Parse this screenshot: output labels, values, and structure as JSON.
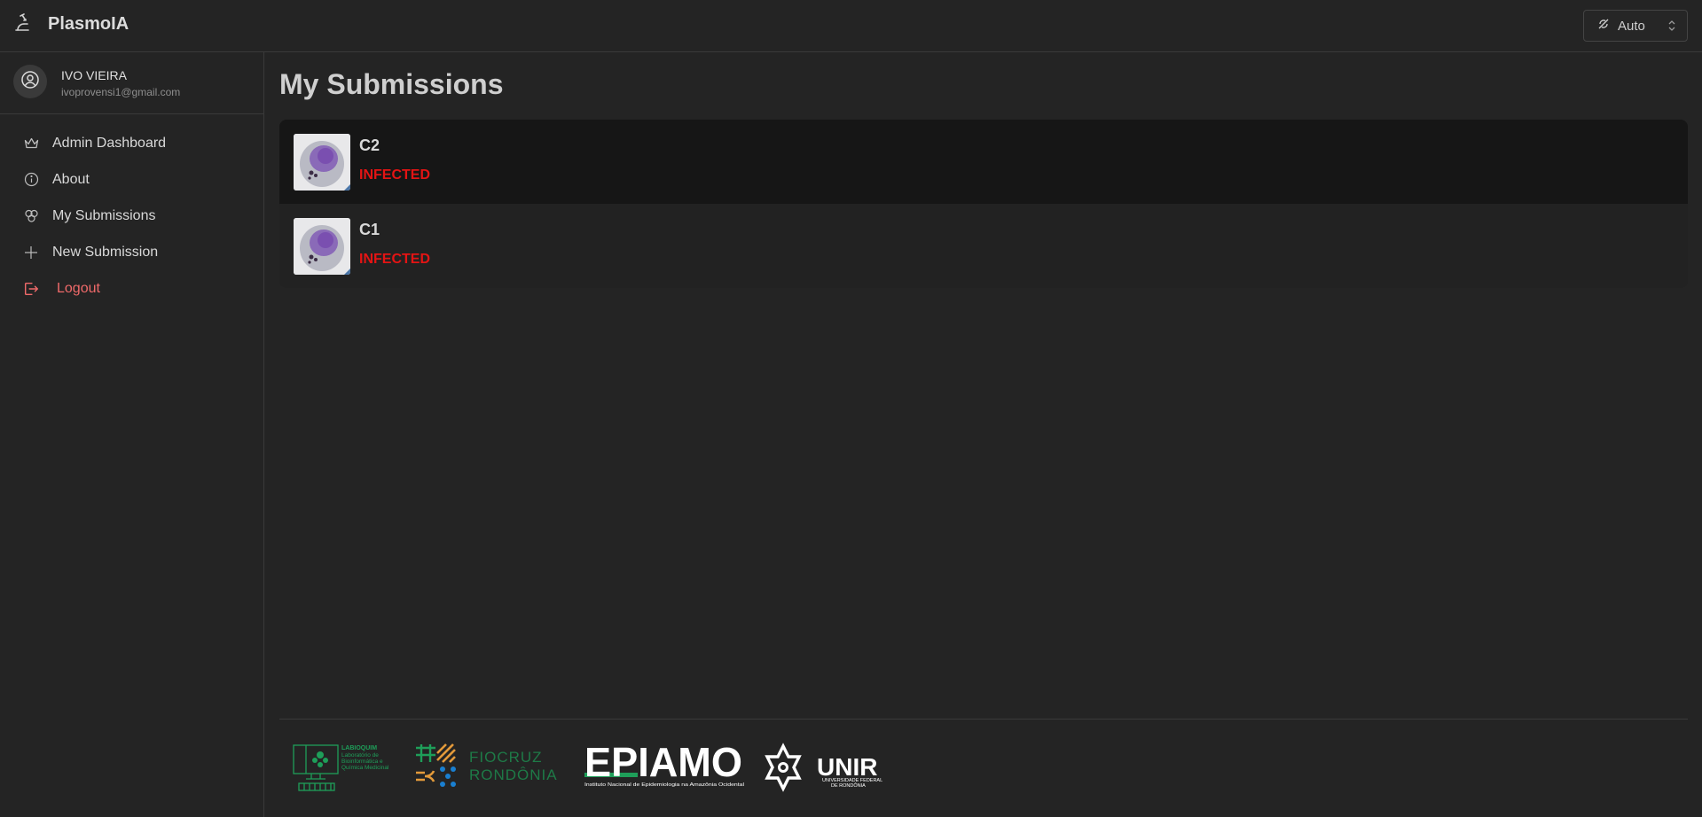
{
  "app": {
    "title": "PlasmoIA"
  },
  "theme": {
    "label": "Auto"
  },
  "user": {
    "name": "IVO VIEIRA",
    "email": "ivoprovensi1@gmail.com"
  },
  "nav": {
    "items": [
      {
        "label": "Admin Dashboard",
        "icon": "crown-icon"
      },
      {
        "label": "About",
        "icon": "info-icon"
      },
      {
        "label": "My Submissions",
        "icon": "circles-icon"
      },
      {
        "label": "New Submission",
        "icon": "plus-icon"
      },
      {
        "label": "Logout",
        "icon": "logout-icon"
      }
    ]
  },
  "main": {
    "title": "My Submissions",
    "submissions": [
      {
        "name": "C2",
        "status": "INFECTED"
      },
      {
        "name": "C1",
        "status": "INFECTED"
      }
    ]
  },
  "footer": {
    "logos": [
      {
        "name": "LABIOQUIM",
        "lines": [
          "LABIOQUIM",
          "Laboratório de",
          "Bioinformática e",
          "Química Medicinal"
        ]
      },
      {
        "name": "FIOCRUZ RONDÔNIA",
        "lines": [
          "FIOCRUZ",
          "RONDÔNIA"
        ]
      },
      {
        "name": "EPIAMO",
        "lines": [
          "EPIAMO",
          "Instituto Nacional de Epidemiologia na Amazônia Ocidental"
        ]
      },
      {
        "name": "UNIR",
        "lines": [
          "UNIR",
          "UNIVERSIDADE FEDERAL",
          "DE RONDÔNIA"
        ]
      }
    ]
  },
  "colors": {
    "background": "#242424",
    "infected": "#e41414",
    "logout": "#f06a6a",
    "accent_green": "#1e9e59"
  }
}
